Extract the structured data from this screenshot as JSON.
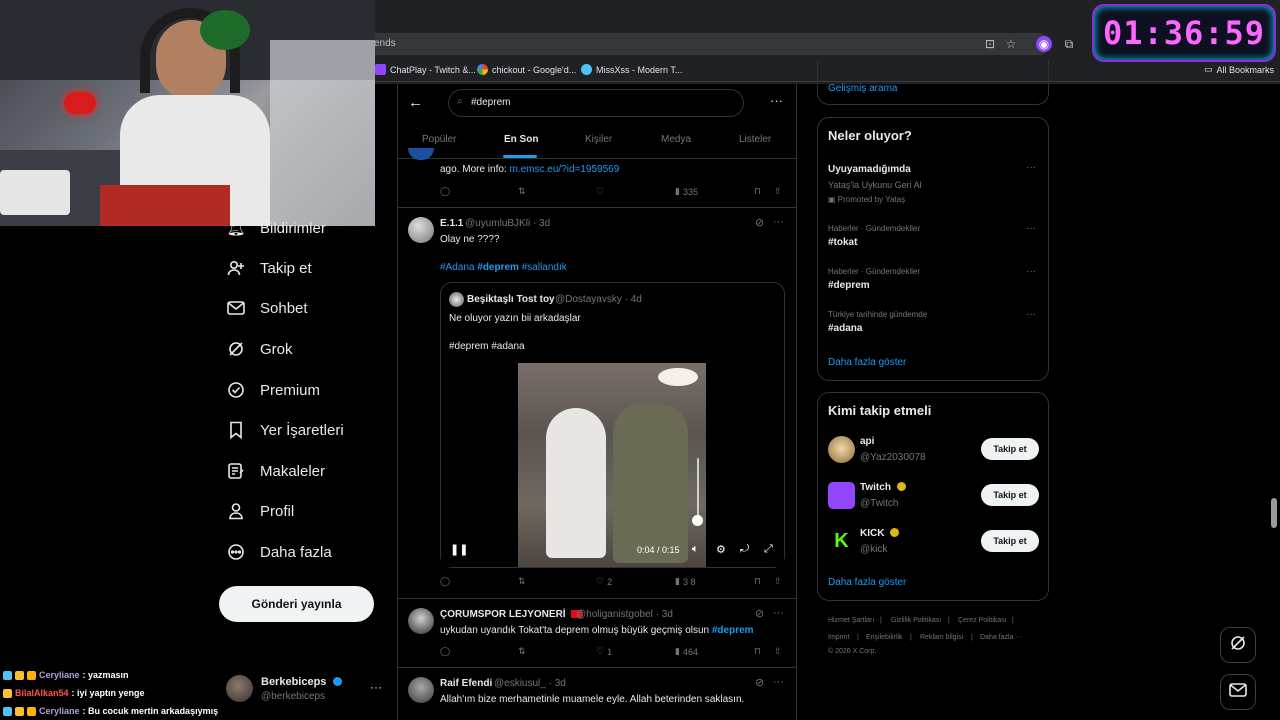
{
  "browser": {
    "address_text": "ends",
    "bookmarks": [
      {
        "label": "ChatPlay - Twitch &...",
        "color": "#9146ff"
      },
      {
        "label": "chickout - Google'd...",
        "color": "#4285f4"
      },
      {
        "label": "MissXss - Modern T...",
        "color": "#4fc3f7"
      }
    ],
    "all_bookmarks": "All Bookmarks"
  },
  "timer": "01:36:59",
  "nav": {
    "items": [
      {
        "label": "Bildirimler",
        "icon": "bell-icon"
      },
      {
        "label": "Takip et",
        "icon": "follow-icon"
      },
      {
        "label": "Sohbet",
        "icon": "mail-icon"
      },
      {
        "label": "Grok",
        "icon": "grok-icon"
      },
      {
        "label": "Premium",
        "icon": "premium-icon"
      },
      {
        "label": "Yer İşaretleri",
        "icon": "bookmark-icon"
      },
      {
        "label": "Makaleler",
        "icon": "article-icon"
      },
      {
        "label": "Profil",
        "icon": "profile-icon"
      },
      {
        "label": "Daha fazla",
        "icon": "more-icon"
      }
    ],
    "post_button": "Gönderi yayınla",
    "profile": {
      "name": "Berkebiceps",
      "handle": "@berkebiceps"
    }
  },
  "chat": [
    {
      "user": "Ceryliane",
      "user_color": "#b39ddb",
      "message": ": yazmasın"
    },
    {
      "user": "BilalAlkan54",
      "user_color": "#ff5252",
      "message": ": iyi yaptın yenge"
    },
    {
      "user": "Ceryliane",
      "user_color": "#b39ddb",
      "message": ": Bu cocuk mertin arkadaşıymış"
    }
  ],
  "search": {
    "query": "#deprem"
  },
  "tabs": [
    "Popüler",
    "En Son",
    "Kişiler",
    "Medya",
    "Listeler"
  ],
  "tweets": {
    "partial": {
      "text_prefix": "ago. More info: ",
      "link": "m.emsc.eu/?id=1959569",
      "views": "335"
    },
    "t1": {
      "name": "E.1.1",
      "handle": "@uyumluBJKli · 3d",
      "text": "Olay ne ????",
      "tags": [
        "#Adana",
        "#deprem",
        "#sallandık"
      ],
      "quote": {
        "name": "Beşiktaşlı Tost toy",
        "handle": "@Dostayavsky · 4d",
        "text": "Ne oluyor yazın bii arkadaşlar",
        "tags": "#deprem #adana",
        "video_time": "0:04 / 0:15"
      },
      "likes": "2",
      "views": "3 8"
    },
    "t2": {
      "name": "ÇORUMSPOR LEJYONERİ",
      "handle": "@holiganistgobel · 3d",
      "text": "uykudan uyandık Tokat'ta deprem olmuş büyük geçmiş olsun ",
      "tag": "#deprem",
      "likes": "1",
      "views": "464"
    },
    "t3": {
      "name": "Raif Efendi",
      "handle": "@eskiusul_ · 3d",
      "text": "Allah'ım  bize merhametinle muamele eyle. Allah beterinden saklasın."
    }
  },
  "right": {
    "advanced_search": "Gelişmiş arama",
    "trends_title": "Neler oluyor?",
    "promoted": {
      "name": "Uyuyamadığımda",
      "desc": "Yataş'la Uykunu Geri Al",
      "label": "Promoted by Yataş"
    },
    "trends": [
      {
        "context": "Haberler · Gündemdekiler",
        "name": "#tokat"
      },
      {
        "context": "Haberler · Gündemdekiler",
        "name": "#deprem"
      },
      {
        "context": "Türkiye tarihinde gündemde",
        "name": "#adana"
      }
    ],
    "show_more": "Daha fazla göster",
    "wtf_title": "Kimi takip etmeli",
    "wtf": [
      {
        "name": "api",
        "handle": "@Yaz2030078",
        "button": "Takip et"
      },
      {
        "name": "Twitch",
        "handle": "@Twitch",
        "button": "Takip et"
      },
      {
        "name": "KICK",
        "handle": "@kick",
        "button": "Takip et"
      }
    ],
    "footer": [
      "Hizmet Şartları",
      "|",
      "Gizlilik Politikası",
      "|",
      "Çerez Politikası",
      "|",
      "Imprint",
      "|",
      "Erişilebilirlik",
      "|",
      "Reklam bilgisi",
      "|",
      "Daha fazla ···",
      "© 2026 X Corp."
    ]
  },
  "colors": {
    "accent": "#1d9bf0",
    "timer": "#ff66ff"
  }
}
